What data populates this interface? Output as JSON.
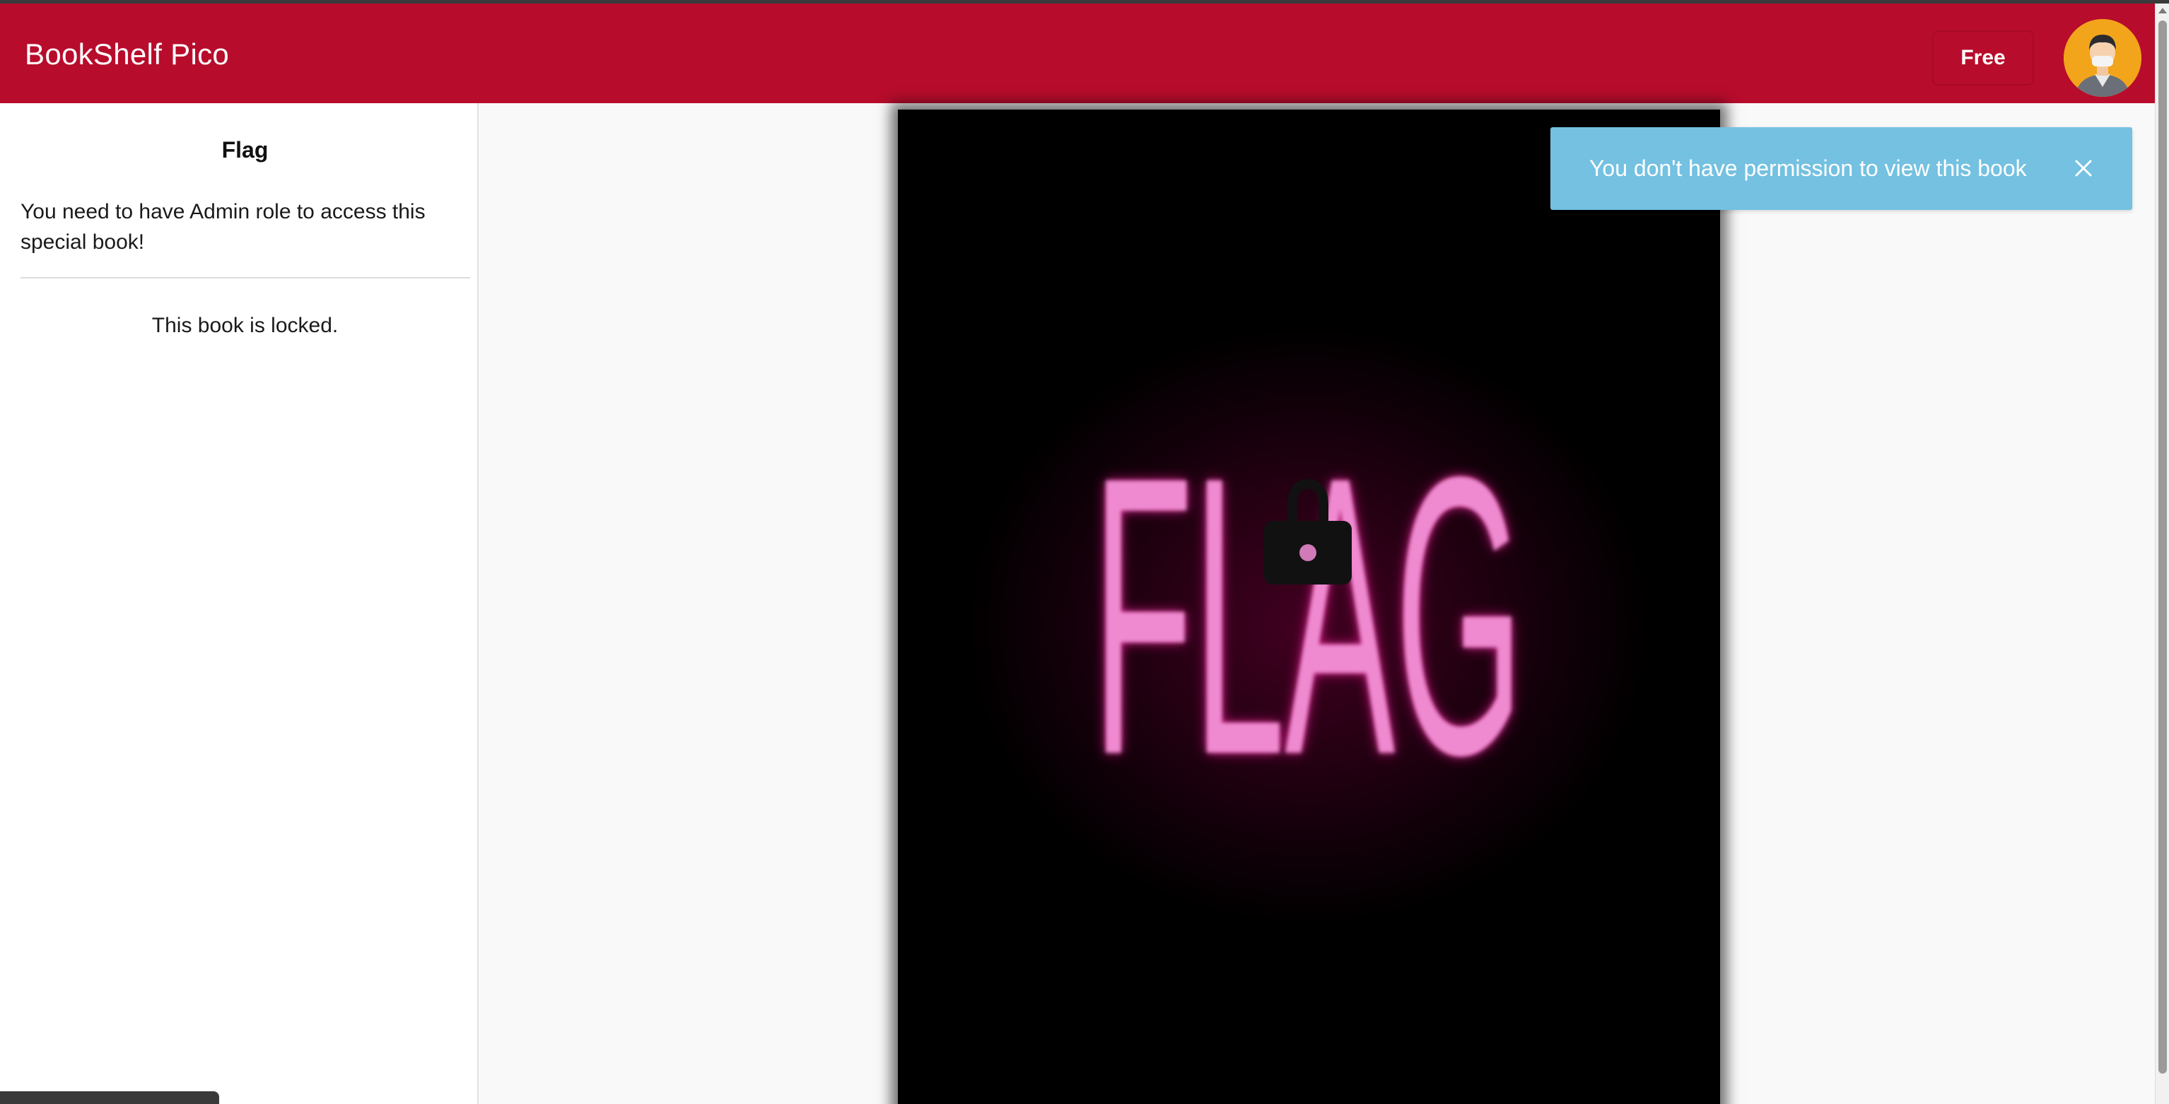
{
  "app": {
    "brand": "BookShelf Pico"
  },
  "header": {
    "plan_label": "Free",
    "avatar_icon": "user-avatar-icon"
  },
  "book": {
    "title": "Flag",
    "description": "You need to have Admin role to access this special book!",
    "locked_message": "This book is locked.",
    "cover_text": "FLAG",
    "lock_icon": "lock-icon"
  },
  "toast": {
    "message": "You don't have permission to view this book",
    "close_icon": "close-icon"
  },
  "colors": {
    "header_bg": "#b80c2c",
    "toast_bg": "#74c1e1",
    "cover_text": "#f08ad0",
    "cover_glow": "#ff1aa0"
  }
}
